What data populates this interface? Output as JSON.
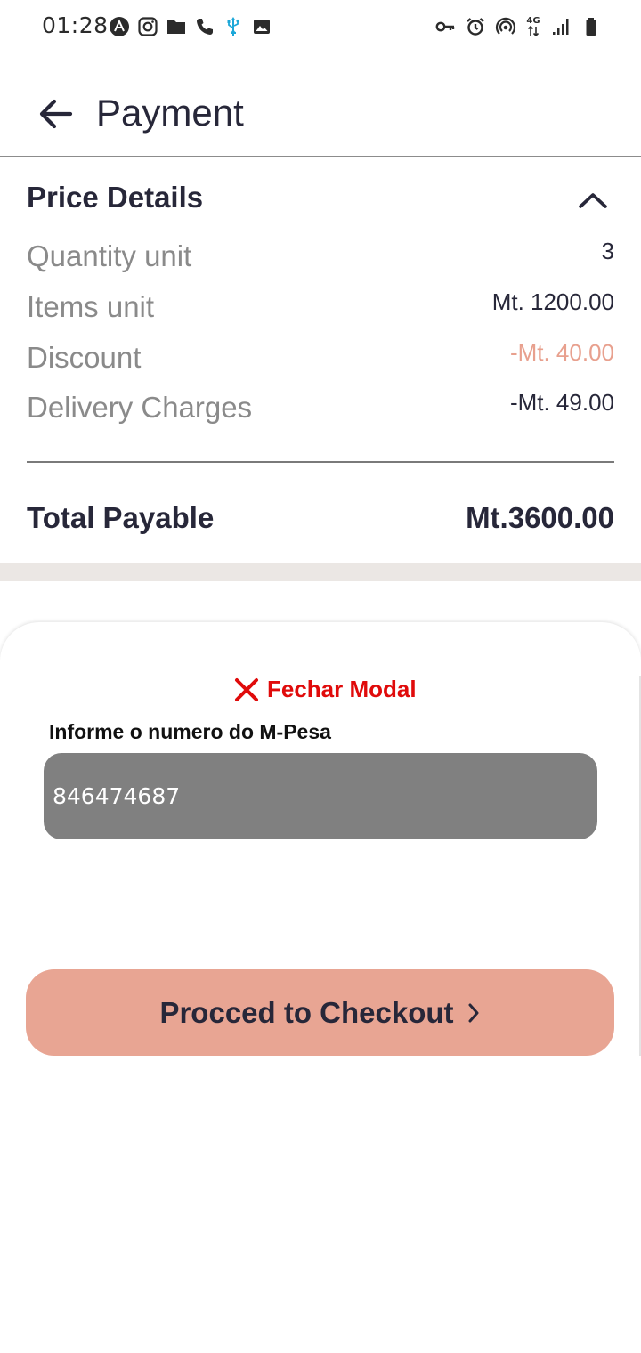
{
  "status_bar": {
    "time": "01:28",
    "left_icons": [
      "app-a-icon",
      "instagram-icon",
      "folder-icon",
      "phone-icon",
      "usb-icon",
      "image-icon"
    ],
    "right_icons": [
      "key-icon",
      "alarm-icon",
      "hotspot-icon",
      "network-4g-icon",
      "signal-icon",
      "battery-icon"
    ],
    "network_label": "4G"
  },
  "header": {
    "title": "Payment"
  },
  "price_details": {
    "title": "Price Details",
    "rows": [
      {
        "label": "Quantity unit",
        "value": "3"
      },
      {
        "label": "Items unit",
        "value": "Mt. 1200.00"
      },
      {
        "label": "Discount",
        "value": "-Mt. 40.00"
      },
      {
        "label": "Delivery Charges",
        "value": "-Mt. 49.00"
      }
    ],
    "total_label": "Total Payable",
    "total_value": "Mt.3600.00"
  },
  "modal": {
    "close_label": "Fechar Modal",
    "field_label": "Informe o numero do M-Pesa",
    "mpesa_number": "846474687",
    "checkout_label": "Procced to Checkout"
  },
  "colors": {
    "accent": "#e8a593",
    "discount": "#e8a08e",
    "close_red": "#e00b0b",
    "text_dark": "#272739",
    "input_bg": "#808080"
  }
}
